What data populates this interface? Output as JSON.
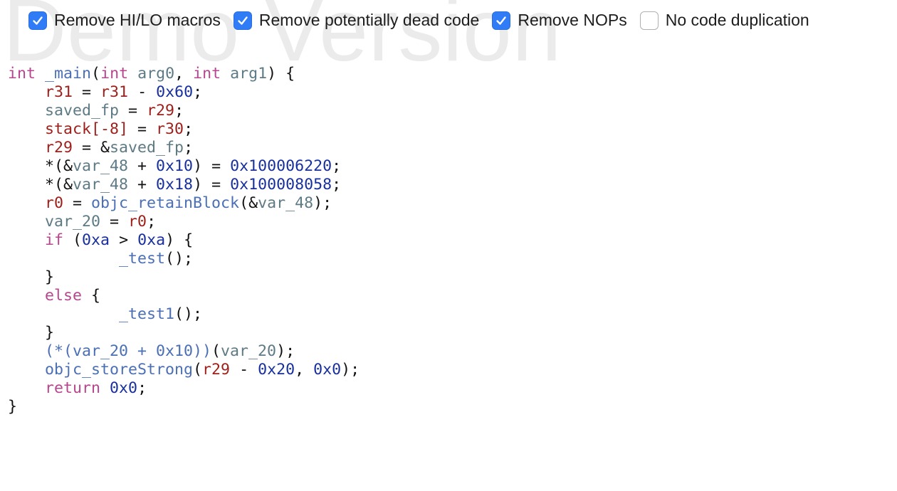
{
  "watermark": "Demo Version",
  "options": [
    {
      "label": "Remove HI/LO macros",
      "checked": true
    },
    {
      "label": "Remove potentially dead code",
      "checked": true
    },
    {
      "label": "Remove NOPs",
      "checked": true
    },
    {
      "label": "No code duplication",
      "checked": false
    }
  ],
  "code_lines": [
    [
      [
        "kw",
        "int"
      ],
      [
        "pl",
        " "
      ],
      [
        "fn",
        "_main"
      ],
      [
        "pl",
        "("
      ],
      [
        "kw",
        "int"
      ],
      [
        "pl",
        " "
      ],
      [
        "vr",
        "arg0"
      ],
      [
        "pl",
        ", "
      ],
      [
        "kw",
        "int"
      ],
      [
        "pl",
        " "
      ],
      [
        "vr",
        "arg1"
      ],
      [
        "pl",
        ") {"
      ]
    ],
    [
      [
        "pl",
        "    "
      ],
      [
        "rg",
        "r31"
      ],
      [
        "pl",
        " = "
      ],
      [
        "rg",
        "r31"
      ],
      [
        "pl",
        " - "
      ],
      [
        "nm",
        "0x60"
      ],
      [
        "pl",
        ";"
      ]
    ],
    [
      [
        "pl",
        "    "
      ],
      [
        "vr",
        "saved_fp"
      ],
      [
        "pl",
        " = "
      ],
      [
        "rg",
        "r29"
      ],
      [
        "pl",
        ";"
      ]
    ],
    [
      [
        "pl",
        "    "
      ],
      [
        "rg",
        "stack[-8]"
      ],
      [
        "pl",
        " = "
      ],
      [
        "rg",
        "r30"
      ],
      [
        "pl",
        ";"
      ]
    ],
    [
      [
        "pl",
        "    "
      ],
      [
        "rg",
        "r29"
      ],
      [
        "pl",
        " = &"
      ],
      [
        "vr",
        "saved_fp"
      ],
      [
        "pl",
        ";"
      ]
    ],
    [
      [
        "pl",
        "    *(&"
      ],
      [
        "vr",
        "var_48"
      ],
      [
        "pl",
        " + "
      ],
      [
        "nm",
        "0x10"
      ],
      [
        "pl",
        ") = "
      ],
      [
        "nm",
        "0x100006220"
      ],
      [
        "pl",
        ";"
      ]
    ],
    [
      [
        "pl",
        "    *(&"
      ],
      [
        "vr",
        "var_48"
      ],
      [
        "pl",
        " + "
      ],
      [
        "nm",
        "0x18"
      ],
      [
        "pl",
        ") = "
      ],
      [
        "nm",
        "0x100008058"
      ],
      [
        "pl",
        ";"
      ]
    ],
    [
      [
        "pl",
        "    "
      ],
      [
        "rg",
        "r0"
      ],
      [
        "pl",
        " = "
      ],
      [
        "fn",
        "objc_retainBlock"
      ],
      [
        "pl",
        "(&"
      ],
      [
        "vr",
        "var_48"
      ],
      [
        "pl",
        ");"
      ]
    ],
    [
      [
        "pl",
        "    "
      ],
      [
        "vr",
        "var_20"
      ],
      [
        "pl",
        " = "
      ],
      [
        "rg",
        "r0"
      ],
      [
        "pl",
        ";"
      ]
    ],
    [
      [
        "pl",
        "    "
      ],
      [
        "kw",
        "if"
      ],
      [
        "pl",
        " ("
      ],
      [
        "nm",
        "0xa"
      ],
      [
        "pl",
        " > "
      ],
      [
        "nm",
        "0xa"
      ],
      [
        "pl",
        ") {"
      ]
    ],
    [
      [
        "pl",
        "            "
      ],
      [
        "fn",
        "_test"
      ],
      [
        "pl",
        "();"
      ]
    ],
    [
      [
        "pl",
        "    }"
      ]
    ],
    [
      [
        "pl",
        "    "
      ],
      [
        "kw",
        "else"
      ],
      [
        "pl",
        " {"
      ]
    ],
    [
      [
        "pl",
        "            "
      ],
      [
        "fn",
        "_test1"
      ],
      [
        "pl",
        "();"
      ]
    ],
    [
      [
        "pl",
        "    }"
      ]
    ],
    [
      [
        "pl",
        "    "
      ],
      [
        "fn",
        "(*(var_20 + 0x10))"
      ],
      [
        "pl",
        "("
      ],
      [
        "vr",
        "var_20"
      ],
      [
        "pl",
        ");"
      ]
    ],
    [
      [
        "pl",
        "    "
      ],
      [
        "fn",
        "objc_storeStrong"
      ],
      [
        "pl",
        "("
      ],
      [
        "rg",
        "r29"
      ],
      [
        "pl",
        " - "
      ],
      [
        "nm",
        "0x20"
      ],
      [
        "pl",
        ", "
      ],
      [
        "nm",
        "0x0"
      ],
      [
        "pl",
        ");"
      ]
    ],
    [
      [
        "pl",
        "    "
      ],
      [
        "kw",
        "return"
      ],
      [
        "pl",
        " "
      ],
      [
        "nm",
        "0x0"
      ],
      [
        "pl",
        ";"
      ]
    ],
    [
      [
        "pl",
        "}"
      ]
    ]
  ],
  "colors": {
    "keyword": "#b8468f",
    "function": "#4a6fb5",
    "register": "#9e1f1a",
    "variable": "#5d7a85",
    "number": "#182f9e",
    "checkbox_accent": "#2f7cf6"
  }
}
